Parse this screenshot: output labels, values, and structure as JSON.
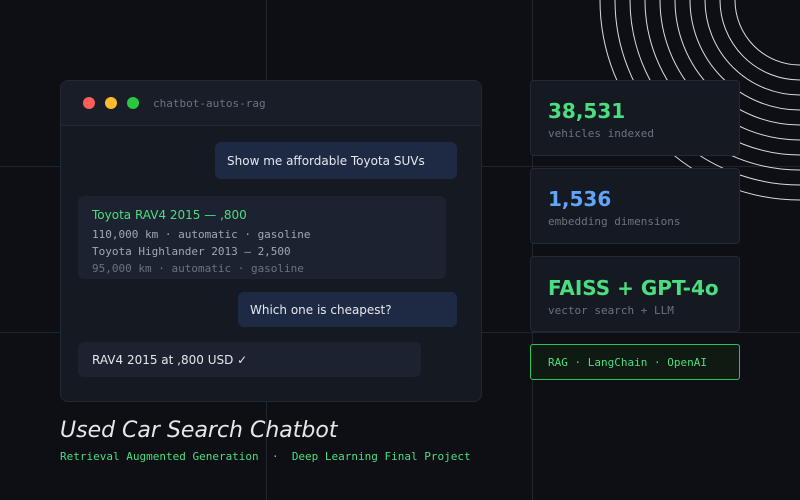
{
  "window": {
    "title": "chatbot-autos-rag"
  },
  "chat": {
    "user_message_1": "Show me affordable Toyota SUVs",
    "bot_reply_1": {
      "result_1_title": "Toyota RAV4 2015 — ,800",
      "result_1_details": "110,000 km · automatic · gasoline",
      "result_2_title": "Toyota Highlander 2013 — 2,500",
      "result_2_details": "95,000 km · automatic · gasoline"
    },
    "user_message_2": "Which one is cheapest?",
    "bot_reply_2": "RAV4 2015 at ,800 USD  ✓"
  },
  "stats": [
    {
      "value": "38,531",
      "label": "vehicles indexed",
      "color": "#4ade80"
    },
    {
      "value": "1,536",
      "label": "embedding dimensions",
      "color": "#60a5fa"
    },
    {
      "value": "FAISS + GPT-4o",
      "label": "vector search + LLM",
      "color": "#4ade80"
    }
  ],
  "tech_tag": "RAG · LangChain · OpenAI",
  "footer": {
    "title": "Used Car Search Chatbot",
    "subtitle_part_1": "Retrieval Augmented Generation",
    "separator": "·",
    "subtitle_part_2": "Deep Learning Final Project"
  },
  "colors": {
    "background": "#0d0f14",
    "accent_green": "#4ade80",
    "accent_blue": "#60a5fa",
    "user_bubble": "#1e2a44"
  }
}
